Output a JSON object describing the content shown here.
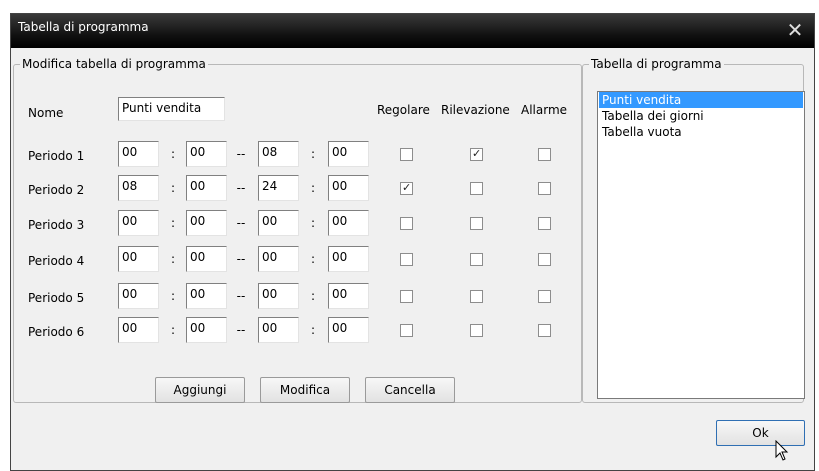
{
  "window": {
    "title": "Tabella di programma",
    "close_glyph": "✕"
  },
  "edit_group": {
    "legend": "Modifica tabella di programma",
    "name_label": "Nome",
    "name_value": "Punti vendita",
    "column_headers": {
      "regolare": "Regolare",
      "rilevazione": "Rilevazione",
      "allarme": "Allarme"
    },
    "time_separator": ":",
    "range_separator": "--",
    "periods": [
      {
        "label": "Periodo 1",
        "start_h": "00",
        "start_m": "00",
        "end_h": "08",
        "end_m": "00",
        "regolare": false,
        "rilevazione": true,
        "allarme": false
      },
      {
        "label": "Periodo 2",
        "start_h": "08",
        "start_m": "00",
        "end_h": "24",
        "end_m": "00",
        "regolare": true,
        "rilevazione": false,
        "allarme": false
      },
      {
        "label": "Periodo 3",
        "start_h": "00",
        "start_m": "00",
        "end_h": "00",
        "end_m": "00",
        "regolare": false,
        "rilevazione": false,
        "allarme": false
      },
      {
        "label": "Periodo 4",
        "start_h": "00",
        "start_m": "00",
        "end_h": "00",
        "end_m": "00",
        "regolare": false,
        "rilevazione": false,
        "allarme": false
      },
      {
        "label": "Periodo 5",
        "start_h": "00",
        "start_m": "00",
        "end_h": "00",
        "end_m": "00",
        "regolare": false,
        "rilevazione": false,
        "allarme": false
      },
      {
        "label": "Periodo 6",
        "start_h": "00",
        "start_m": "00",
        "end_h": "00",
        "end_m": "00",
        "regolare": false,
        "rilevazione": false,
        "allarme": false
      }
    ],
    "buttons": {
      "add": "Aggiungi",
      "edit": "Modifica",
      "delete": "Cancella"
    }
  },
  "table_group": {
    "legend": "Tabella di programma",
    "items": [
      "Punti vendita",
      "Tabella dei giorni",
      "Tabella vuota"
    ],
    "selected_item": "Punti vendita"
  },
  "ok_button": "Ok",
  "colors": {
    "selection": "#3399ff",
    "titlebar": "#000000"
  },
  "check_glyph": "✓"
}
